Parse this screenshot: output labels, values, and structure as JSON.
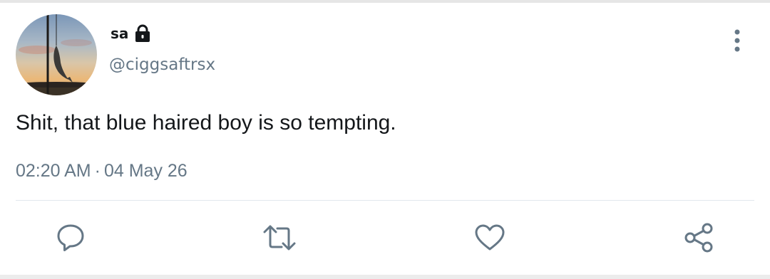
{
  "tweet": {
    "display_name": "sa",
    "handle": "@ciggsaftrsx",
    "text": "Shit, that blue haired boy is so tempting.",
    "time": "02:20 AM",
    "separator": "·",
    "date": "04 May 26"
  },
  "icons": {
    "lock": "lock-icon",
    "more": "more-vertical-icon",
    "reply": "reply-icon",
    "retweet": "retweet-icon",
    "like": "heart-icon",
    "share": "share-icon"
  },
  "colors": {
    "text_primary": "#14171a",
    "text_secondary": "#657786",
    "icon": "#657786",
    "divider": "#e1e8ed"
  }
}
